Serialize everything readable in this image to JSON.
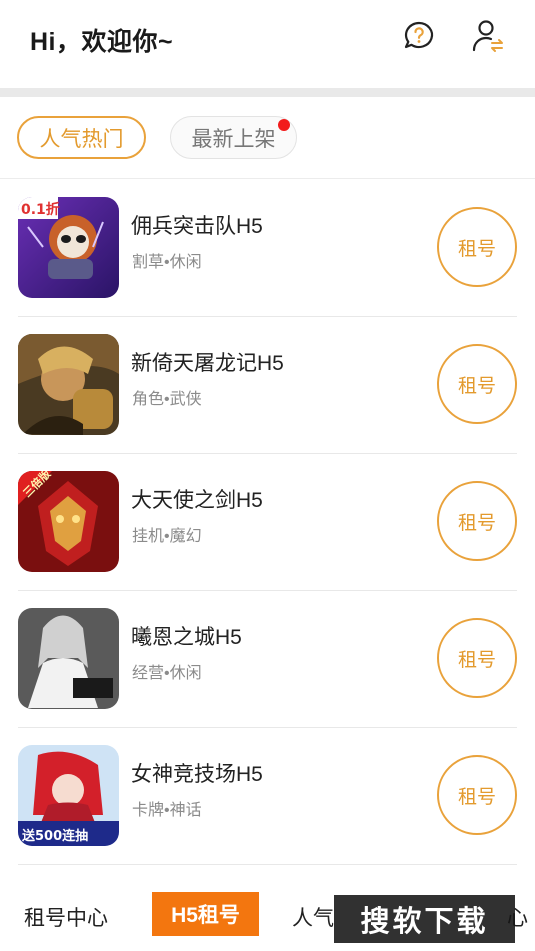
{
  "header": {
    "greeting": "Hi，欢迎你~",
    "help_icon": "question-bubble-icon",
    "user_icon": "user-switch-icon"
  },
  "tabs": [
    {
      "label": "人气热门",
      "active": true
    },
    {
      "label": "最新上架",
      "active": false,
      "has_dot": true
    }
  ],
  "games": [
    {
      "title": "佣兵突击队H5",
      "tags": "割草•休闲",
      "button": "租号",
      "badge": "0.1折"
    },
    {
      "title": "新倚天屠龙记H5",
      "tags": "角色•武侠",
      "button": "租号"
    },
    {
      "title": "大天使之剑H5",
      "tags": "挂机•魔幻",
      "button": "租号",
      "badge": "三倍版"
    },
    {
      "title": "曦恩之城H5",
      "tags": "经营•休闲",
      "button": "租号"
    },
    {
      "title": "女神竞技场H5",
      "tags": "卡牌•神话",
      "button": "租号",
      "badge": "送500连抽"
    }
  ],
  "bottom_nav": [
    {
      "label": "租号中心"
    },
    {
      "label": "H5租号",
      "active": true
    },
    {
      "label": "人气"
    },
    {
      "label": "心"
    }
  ],
  "watermark": "搜软下载",
  "colors": {
    "accent": "#e9a23b",
    "nav_active": "#f3760f",
    "dot": "#f21b1b"
  }
}
